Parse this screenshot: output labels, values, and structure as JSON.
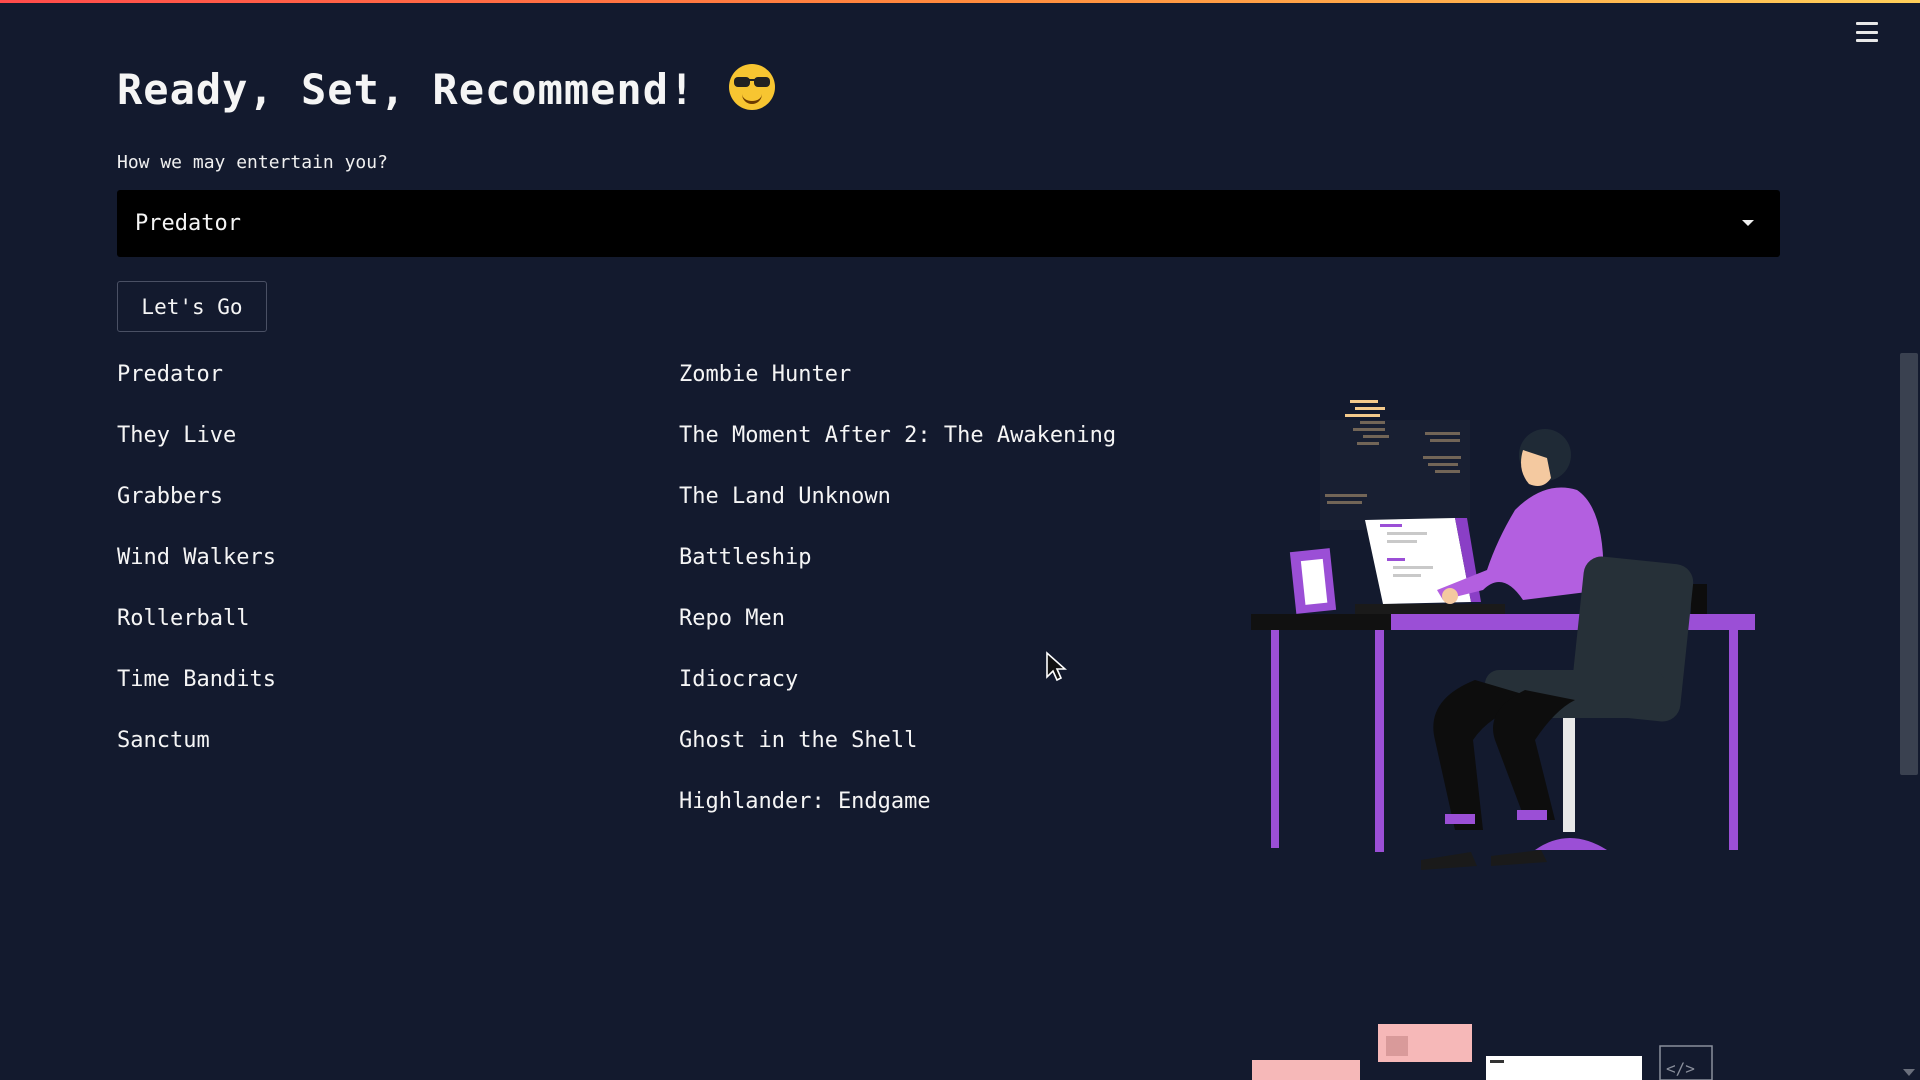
{
  "header": {
    "title": "Ready, Set, Recommend!",
    "emoji_icon": "smiling-face-with-sunglasses-icon"
  },
  "search": {
    "label": "How we may entertain you?",
    "selected_value": "Predator"
  },
  "actions": {
    "go_label": "Let's Go"
  },
  "results": {
    "column1": [
      "Predator",
      "They Live",
      "Grabbers",
      "Wind Walkers",
      "Rollerball",
      "Time Bandits",
      "Sanctum"
    ],
    "column2": [
      "Zombie Hunter",
      "The Moment After 2: The Awakening",
      "The Land Unknown",
      "Battleship",
      "Repo Men",
      "Idiocracy",
      "Ghost in the Shell",
      "Highlander: Endgame"
    ]
  },
  "colors": {
    "background": "#131a2e",
    "accent_gradient": [
      "#ff4b4b",
      "#ffcf5a"
    ],
    "illustration_accent": "#9b4fd6"
  },
  "icons": {
    "menu": "hamburger-menu-icon",
    "dropdown": "chevron-down-icon"
  }
}
